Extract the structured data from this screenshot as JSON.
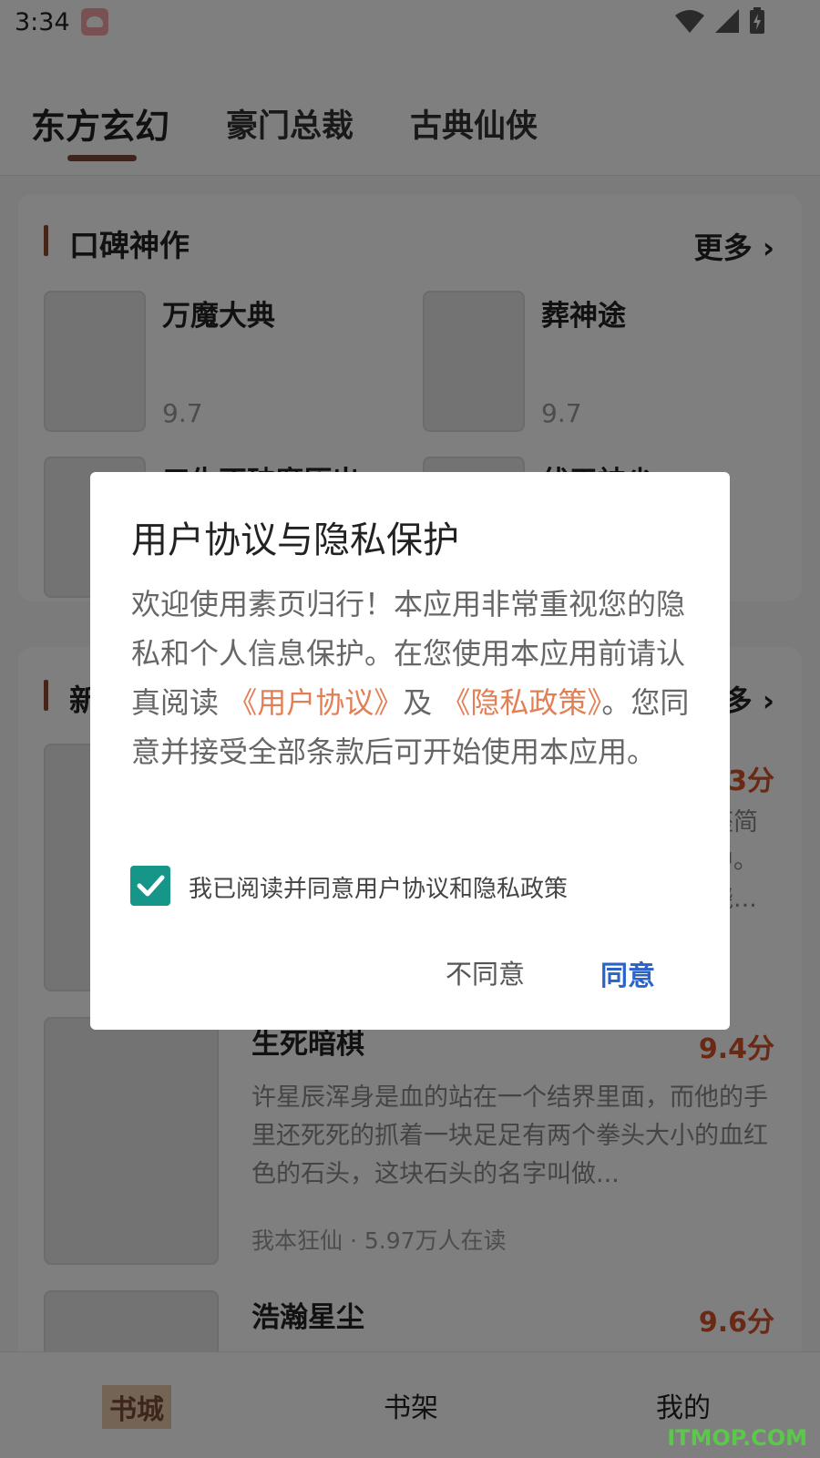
{
  "status_bar": {
    "time": "3:34",
    "icons": [
      "app-notification-icon",
      "wifi-icon",
      "signal-icon",
      "battery-charging-icon"
    ]
  },
  "tabs": [
    {
      "label": "东方玄幻",
      "active": true
    },
    {
      "label": "豪门总裁",
      "active": false
    },
    {
      "label": "古典仙侠",
      "active": false
    }
  ],
  "section1": {
    "title": "口碑神作",
    "more": "更多",
    "books": [
      {
        "title": "万魔大典",
        "score": "9.7"
      },
      {
        "title": "葬神途",
        "score": "9.7"
      },
      {
        "title": "三生不破魔压出",
        "score": ""
      },
      {
        "title": "伏天神尘",
        "score": ""
      }
    ]
  },
  "section2": {
    "title": "新",
    "more": "多",
    "books": [
      {
        "title": "",
        "score": "3分",
        "desc": "座简\n中。\n饶..."
      },
      {
        "title": "生死暗棋",
        "score": "9.4分",
        "desc": "许星辰浑身是血的站在一个结界里面，而他的手里还死死的抓着一块足足有两个拳头大小的血红色的石头，这块石头的名字叫做...",
        "meta": "我本狂仙 · 5.97万人在读"
      },
      {
        "title": "浩瀚星尘",
        "score": "9.6分"
      }
    ]
  },
  "bottom_nav": [
    {
      "label": "书城",
      "active": true
    },
    {
      "label": "书架",
      "active": false
    },
    {
      "label": "我的",
      "active": false
    }
  ],
  "dialog": {
    "title": "用户协议与隐私保护",
    "body_part1": "欢迎使用素页归行！本应用非常重视您的隐私和个人信息保护。在您使用本应用前请认真阅读",
    "link_user_agreement": "《用户协议》",
    "body_and": "及",
    "link_privacy": "《隐私政策》",
    "body_part2": "。您同意并接受全部条款后可开始使用本应用。",
    "checkbox_label": "我已阅读并同意用户协议和隐私政策",
    "checkbox_checked": true,
    "decline_label": "不同意",
    "agree_label": "同意"
  },
  "watermark": "ITMOP.COM",
  "colors": {
    "accent_brown": "#7a4a36",
    "link": "#e37f54",
    "agree_blue": "#2b63c7",
    "checkbox_teal": "#159688",
    "score_red": "#d2522a"
  }
}
